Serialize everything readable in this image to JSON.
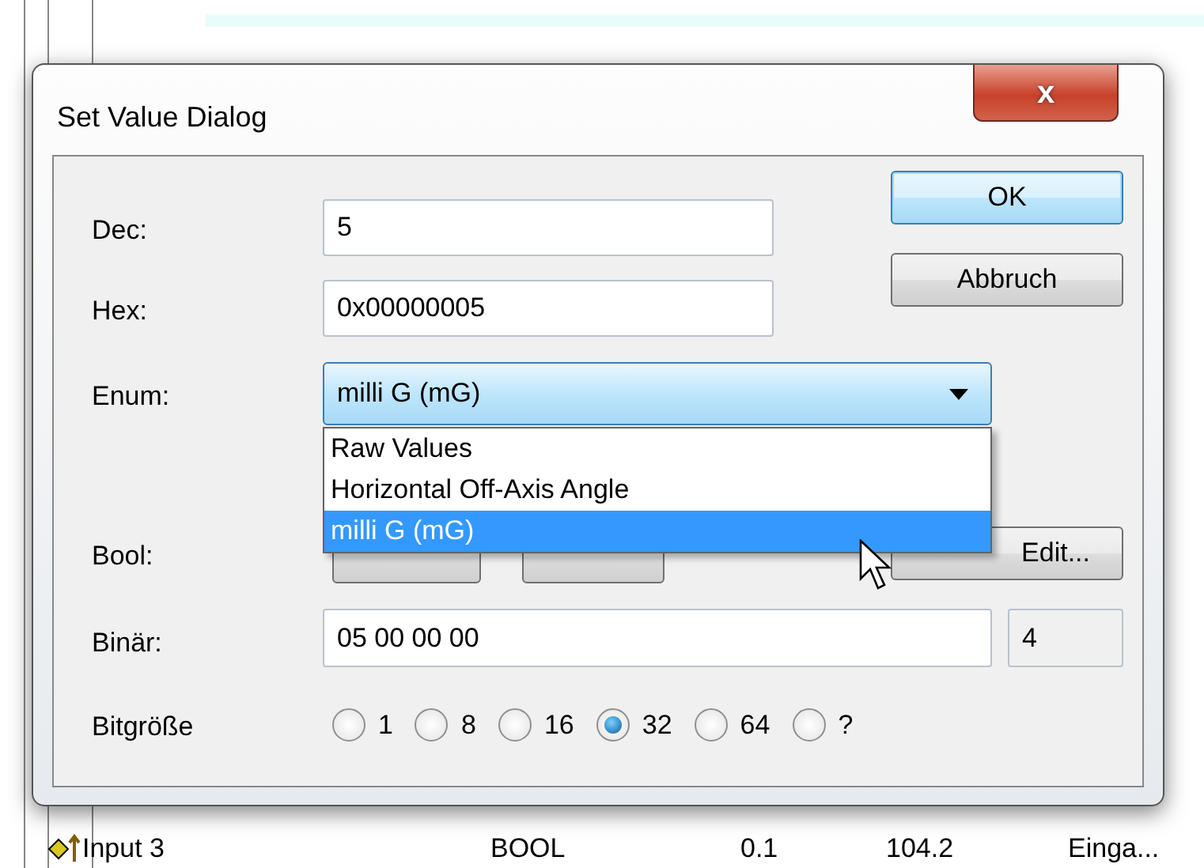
{
  "background_row": {
    "name": "Input 3",
    "type": "BOOL",
    "size": "0.1",
    "address": "104.2",
    "column_5": "Einga..."
  },
  "window": {
    "title": "Set Value Dialog",
    "close": "x"
  },
  "fields": [
    {
      "label": "Dec:",
      "value": "5"
    },
    {
      "label": "Hex:",
      "value": "0x00000005"
    }
  ],
  "buttons": [
    {
      "label": "OK",
      "default": true
    },
    {
      "label": "Abbruch",
      "default": false
    }
  ],
  "enum": {
    "label": "Enum:",
    "value": "milli G (mG)",
    "expanded": true,
    "options": [
      {
        "label": "Raw Values",
        "selected": false
      },
      {
        "label": "Horizontal Off-Axis Angle",
        "selected": false
      },
      {
        "label": "milli G (mG)",
        "selected": true
      }
    ]
  },
  "bool": {
    "label": "Bool:",
    "hex_edit": "Edit..."
  },
  "binary": {
    "label": "Binär:",
    "value": "05 00 00 00",
    "length": "4"
  },
  "bitsize": {
    "label": "Bitgröße",
    "options": [
      {
        "label": "1",
        "selected": false
      },
      {
        "label": "8",
        "selected": false
      },
      {
        "label": "16",
        "selected": false
      },
      {
        "label": "32",
        "selected": true
      },
      {
        "label": "64",
        "selected": false
      },
      {
        "label": "?",
        "selected": false
      }
    ]
  }
}
